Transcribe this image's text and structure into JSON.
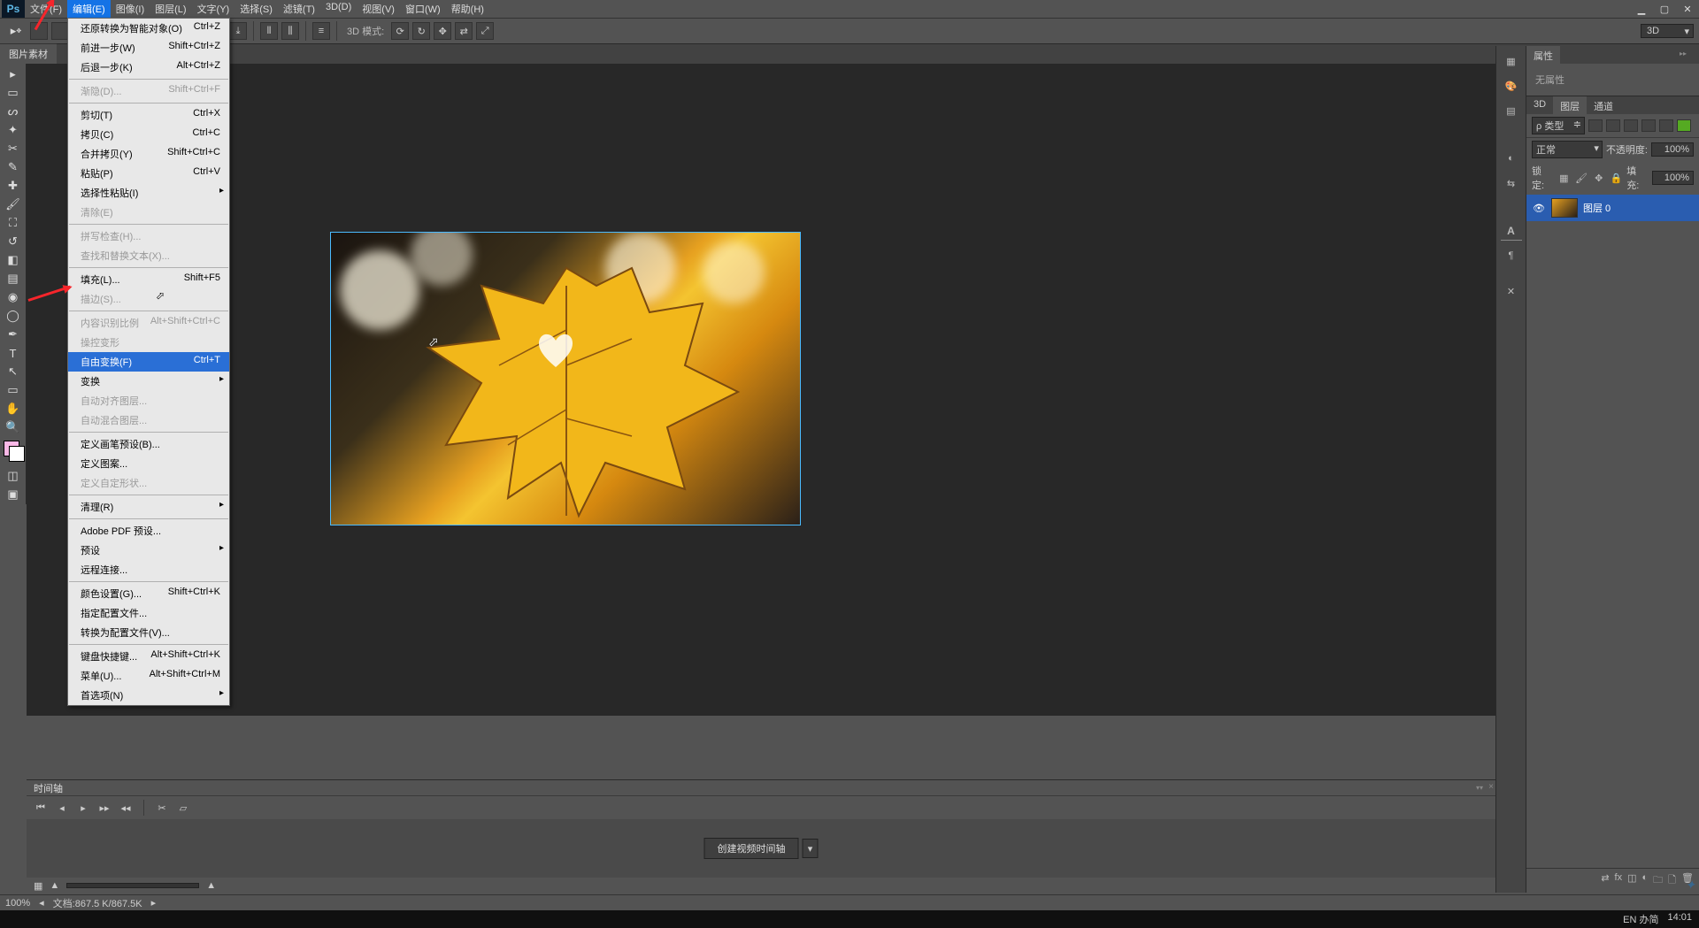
{
  "menu": {
    "items": [
      "文件(F)",
      "编辑(E)",
      "图像(I)",
      "图层(L)",
      "文字(Y)",
      "选择(S)",
      "滤镜(T)",
      "3D(D)",
      "视图(V)",
      "窗口(W)",
      "帮助(H)"
    ],
    "active_index": 1
  },
  "window_controls": {
    "min": "▁",
    "max": "▢",
    "close": "✕"
  },
  "options_bar": {
    "mode_label": "3D 模式:",
    "dropdown_value": "3D"
  },
  "doc_tab": {
    "title": "图片素材"
  },
  "edit_menu": {
    "groups": [
      [
        {
          "label": "还原转换为智能对象(O)",
          "shortcut": "Ctrl+Z"
        },
        {
          "label": "前进一步(W)",
          "shortcut": "Shift+Ctrl+Z"
        },
        {
          "label": "后退一步(K)",
          "shortcut": "Alt+Ctrl+Z"
        }
      ],
      [
        {
          "label": "渐隐(D)...",
          "shortcut": "Shift+Ctrl+F",
          "disabled": true
        }
      ],
      [
        {
          "label": "剪切(T)",
          "shortcut": "Ctrl+X"
        },
        {
          "label": "拷贝(C)",
          "shortcut": "Ctrl+C"
        },
        {
          "label": "合并拷贝(Y)",
          "shortcut": "Shift+Ctrl+C"
        },
        {
          "label": "粘贴(P)",
          "shortcut": "Ctrl+V"
        },
        {
          "label": "选择性粘贴(I)",
          "shortcut": "",
          "sub": true
        },
        {
          "label": "清除(E)",
          "shortcut": "",
          "disabled": true
        }
      ],
      [
        {
          "label": "拼写检查(H)...",
          "shortcut": "",
          "disabled": true
        },
        {
          "label": "查找和替换文本(X)...",
          "shortcut": "",
          "disabled": true
        }
      ],
      [
        {
          "label": "填充(L)...",
          "shortcut": "Shift+F5"
        },
        {
          "label": "描边(S)...",
          "shortcut": "",
          "disabled": true
        }
      ],
      [
        {
          "label": "内容识别比例",
          "shortcut": "Alt+Shift+Ctrl+C",
          "disabled": true
        },
        {
          "label": "操控变形",
          "shortcut": "",
          "disabled": true
        },
        {
          "label": "自由变换(F)",
          "shortcut": "Ctrl+T",
          "hl": true
        },
        {
          "label": "变换",
          "shortcut": "",
          "sub": true
        },
        {
          "label": "自动对齐图层...",
          "shortcut": "",
          "disabled": true
        },
        {
          "label": "自动混合图层...",
          "shortcut": "",
          "disabled": true
        }
      ],
      [
        {
          "label": "定义画笔预设(B)...",
          "shortcut": ""
        },
        {
          "label": "定义图案...",
          "shortcut": ""
        },
        {
          "label": "定义自定形状...",
          "shortcut": "",
          "disabled": true
        }
      ],
      [
        {
          "label": "清理(R)",
          "shortcut": "",
          "sub": true
        }
      ],
      [
        {
          "label": "Adobe PDF 预设...",
          "shortcut": ""
        },
        {
          "label": "预设",
          "shortcut": "",
          "sub": true
        },
        {
          "label": "远程连接...",
          "shortcut": ""
        }
      ],
      [
        {
          "label": "颜色设置(G)...",
          "shortcut": "Shift+Ctrl+K"
        },
        {
          "label": "指定配置文件...",
          "shortcut": ""
        },
        {
          "label": "转换为配置文件(V)...",
          "shortcut": ""
        }
      ],
      [
        {
          "label": "键盘快捷键...",
          "shortcut": "Alt+Shift+Ctrl+K"
        },
        {
          "label": "菜单(U)...",
          "shortcut": "Alt+Shift+Ctrl+M"
        },
        {
          "label": "首选项(N)",
          "shortcut": "",
          "sub": true
        }
      ]
    ]
  },
  "timeline": {
    "title": "时间轴",
    "create_btn": "创建视频时间轴"
  },
  "status": {
    "zoom": "100%",
    "doc": "文档:867.5 K/867.5K"
  },
  "properties": {
    "tab": "属性",
    "empty": "无属性"
  },
  "layers": {
    "tabs": [
      "3D",
      "图层",
      "通道"
    ],
    "active_tab": 1,
    "filter_label": "ρ 类型",
    "blend_mode": "正常",
    "opacity_label": "不透明度:",
    "opacity_value": "100%",
    "lock_label": "锁定:",
    "fill_label": "填充:",
    "fill_value": "100%",
    "layer_name": "图层 0"
  },
  "ime": {
    "lang": "EN 办简"
  },
  "clock": {
    "time": "14:01"
  }
}
